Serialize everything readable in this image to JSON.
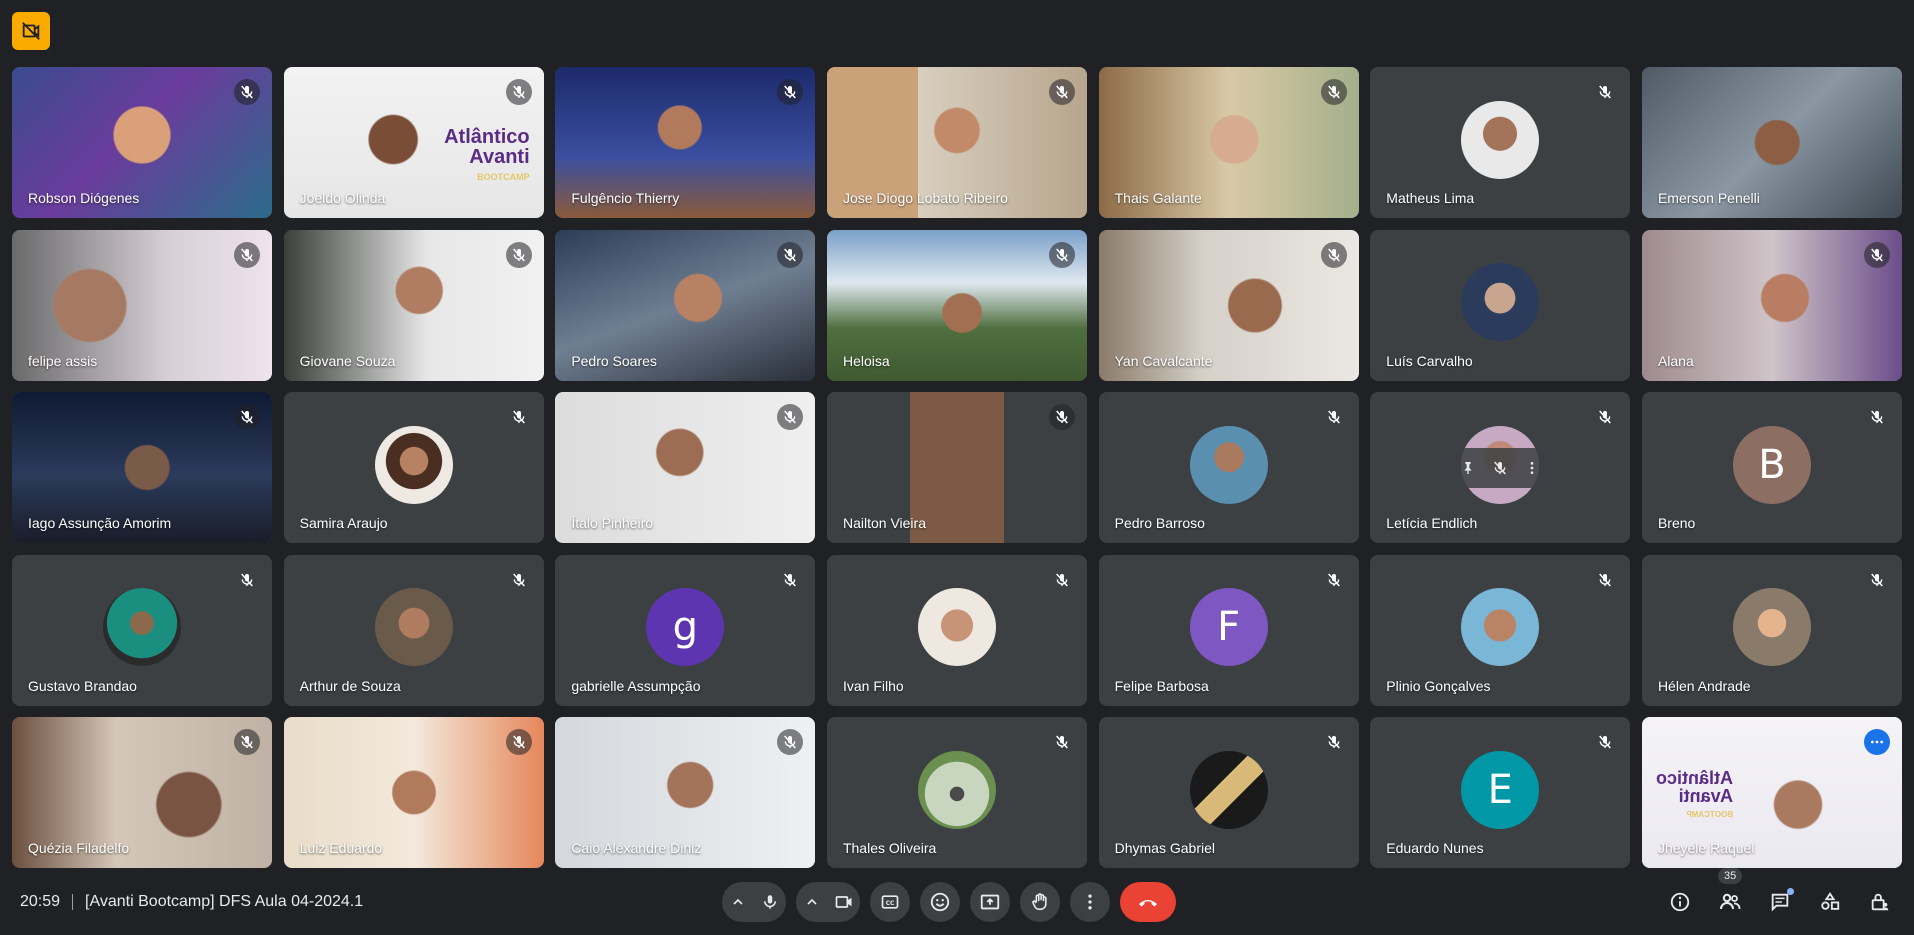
{
  "colors": {
    "background": "#202124",
    "tile": "#3c4043",
    "hangup": "#ea4335",
    "accent": "#8ab4f8",
    "badge": "#f9ab00"
  },
  "top_badge": {
    "icon": "camera-off-icon"
  },
  "participants": [
    {
      "name": "Robson Diógenes",
      "type": "video",
      "muted": true
    },
    {
      "name": "Joeldo Olinda",
      "type": "video",
      "muted": true
    },
    {
      "name": "Fulgêncio Thierry",
      "type": "video",
      "muted": true
    },
    {
      "name": "Jose Diogo Lobato Ribeiro",
      "type": "video",
      "muted": true
    },
    {
      "name": "Thais Galante",
      "type": "video",
      "muted": true
    },
    {
      "name": "Matheus Lima",
      "type": "avatar",
      "muted": true
    },
    {
      "name": "Emerson Penelli",
      "type": "video",
      "muted": false
    },
    {
      "name": "felipe assis",
      "type": "video",
      "muted": true
    },
    {
      "name": "Giovane Souza",
      "type": "video",
      "muted": true
    },
    {
      "name": "Pedro Soares",
      "type": "video",
      "muted": true
    },
    {
      "name": "Heloisa",
      "type": "video",
      "muted": true
    },
    {
      "name": "Yan Cavalcante",
      "type": "video",
      "muted": true
    },
    {
      "name": "Luís Carvalho",
      "type": "avatar",
      "muted": false
    },
    {
      "name": "Alana",
      "type": "video",
      "muted": true
    },
    {
      "name": "Iago Assunção Amorim",
      "type": "video",
      "muted": true
    },
    {
      "name": "Samira Araujo",
      "type": "avatar",
      "muted": true
    },
    {
      "name": "Ítalo Pinheiro",
      "type": "video",
      "muted": true
    },
    {
      "name": "Nailton Vieira",
      "type": "video",
      "muted": true
    },
    {
      "name": "Pedro Barroso",
      "type": "avatar",
      "muted": true
    },
    {
      "name": "Letícia Endlich",
      "type": "avatar",
      "muted": true
    },
    {
      "name": "Breno",
      "type": "letter",
      "letter": "B",
      "color": "#8d6e63",
      "muted": true
    },
    {
      "name": "Gustavo Brandao",
      "type": "avatar",
      "muted": true
    },
    {
      "name": "Arthur de Souza",
      "type": "avatar",
      "muted": true
    },
    {
      "name": "gabrielle Assumpção",
      "type": "letter",
      "letter": "g",
      "color": "#5e35b1",
      "muted": true
    },
    {
      "name": "Ivan Filho",
      "type": "avatar",
      "muted": true
    },
    {
      "name": "Felipe Barbosa",
      "type": "letter",
      "letter": "F",
      "color": "#7e57c2",
      "muted": true
    },
    {
      "name": "Plinio Gonçalves",
      "type": "avatar",
      "muted": true
    },
    {
      "name": "Hélen Andrade",
      "type": "avatar",
      "muted": true
    },
    {
      "name": "Quézia Filadelfo",
      "type": "video",
      "muted": true
    },
    {
      "name": "Luiz Eduardo",
      "type": "video",
      "muted": true
    },
    {
      "name": "Caio Alexandre Diniz",
      "type": "video",
      "muted": true
    },
    {
      "name": "Thales Oliveira",
      "type": "avatar",
      "muted": true
    },
    {
      "name": "Dhymas Gabriel",
      "type": "avatar",
      "muted": true
    },
    {
      "name": "Eduardo Nunes",
      "type": "letter",
      "letter": "E",
      "color": "#0097a7",
      "muted": true
    },
    {
      "name": "Jheyele Raquel",
      "type": "video",
      "muted": false,
      "active": true
    }
  ],
  "logo": {
    "line1": "Atlântico",
    "line2": "Avanti",
    "line3": "BOOTCAMP"
  },
  "mirrored_logo": {
    "line1": "Atlântico",
    "line2": "Avanti",
    "line3": "BOOTCAMP"
  },
  "bottom_bar": {
    "time": "20:59",
    "meeting_title": "[Avanti Bootcamp] DFS Aula 04-2024.1",
    "participant_count": "35"
  }
}
